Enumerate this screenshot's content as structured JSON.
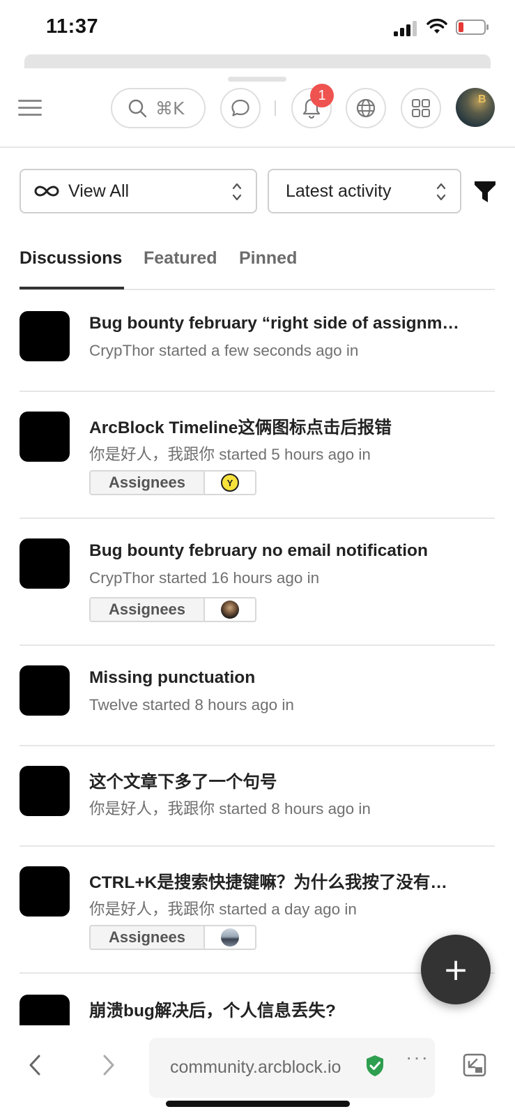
{
  "status_bar": {
    "time": "11:37"
  },
  "header": {
    "search_shortcut": "⌘K",
    "notification_count": "1",
    "avatar_letter": "B"
  },
  "filters": {
    "view_all": "View All",
    "sort": "Latest activity"
  },
  "tabs": [
    "Discussions",
    "Featured",
    "Pinned"
  ],
  "topics": [
    {
      "title": "Bug bounty february “right side of assignm…",
      "meta": "CrypThor started a few seconds ago in",
      "assignees": null
    },
    {
      "title": "ArcBlock Timeline这俩图标点击后报错",
      "meta": "你是好人，我跟你 started 5 hours ago in",
      "assignees": "Assignees",
      "assignee_avatar": "Y"
    },
    {
      "title": "Bug bounty february no email notification",
      "meta": "CrypThor started 16 hours ago in",
      "assignees": "Assignees"
    },
    {
      "title": "Missing punctuation",
      "meta": "Twelve started 8 hours ago in",
      "assignees": null
    },
    {
      "title": "这个文章下多了一个句号",
      "meta": "你是好人，我跟你 started 8 hours ago in",
      "assignees": null
    },
    {
      "title": "CTRL+K是搜索快捷键嘛？为什么我按了没有…",
      "meta": "你是好人，我跟你 started a day ago in",
      "assignees": "Assignees"
    },
    {
      "title": "崩溃bug解决后，个人信息丢失?"
    }
  ],
  "fab": {
    "label": "+"
  },
  "browser": {
    "url": "community.arcblock.io",
    "more": "···"
  },
  "colors": {
    "badge": "#ef5350",
    "shield": "#2e9e4f",
    "fab": "#333333",
    "battery_low": "#e53935"
  }
}
